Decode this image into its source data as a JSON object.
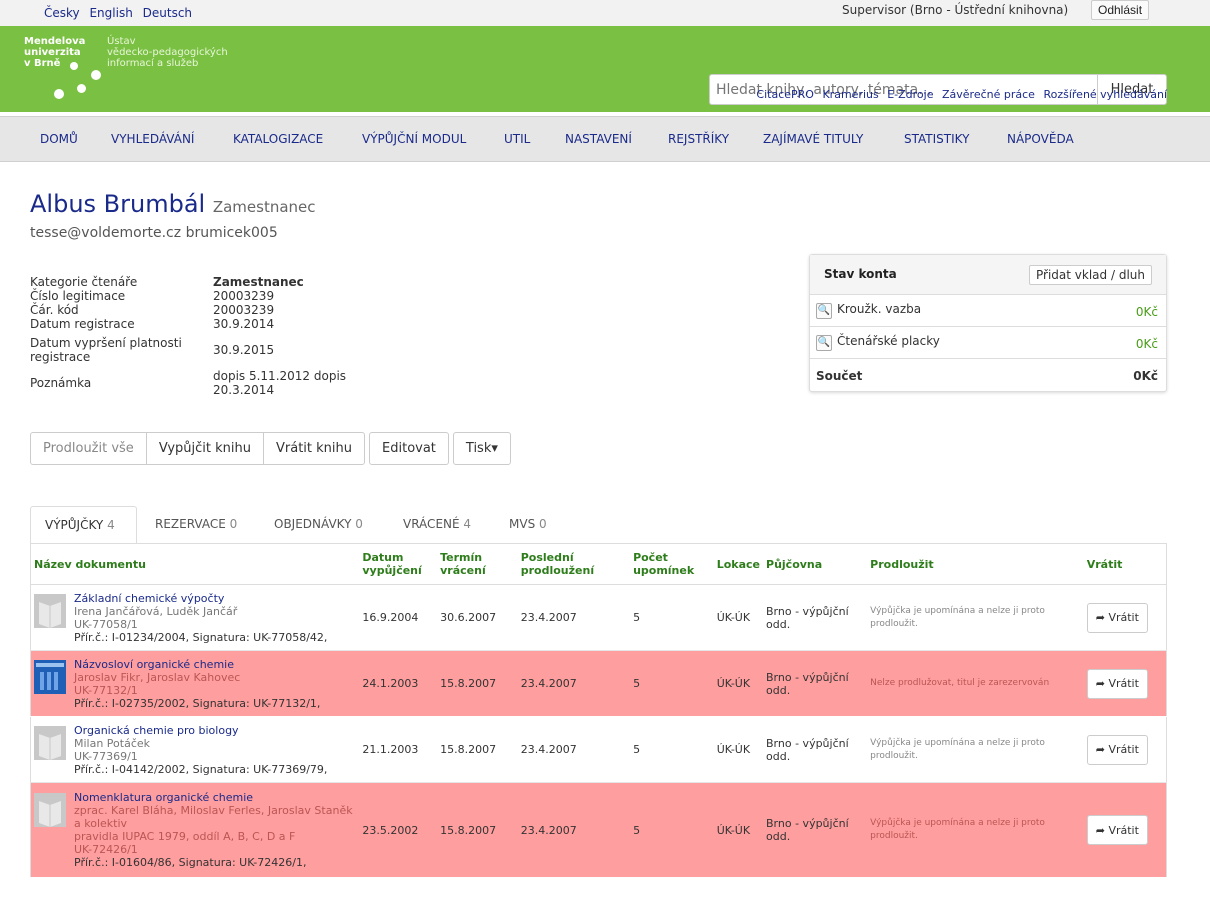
{
  "top": {
    "languages": [
      "Česky",
      "English",
      "Deutsch"
    ],
    "supervisor": "Supervisor (Brno - Ústřední knihovna)",
    "logout": "Odhlásit"
  },
  "header": {
    "logo_lines": [
      "Mendelova",
      "univerzita",
      "v Brně"
    ],
    "unit_lines": [
      "Ústav",
      "vědecko-pedagogických",
      "informací a služeb"
    ],
    "search_placeholder": "Hledat knihy, autory, témata...",
    "search_button": "Hledat",
    "links": [
      "CitacePRO",
      "Kramerius",
      "E-Zdroje",
      "Závěrečné práce",
      "Rozšířené vyhledávání"
    ]
  },
  "nav": [
    "DOMŮ",
    "VYHLEDÁVÁNÍ",
    "KATALOGIZACE",
    "VÝPŮJČNÍ MODUL",
    "UTIL",
    "NASTAVENÍ",
    "REJSTŘÍKY",
    "ZAJÍMAVÉ TITULY",
    "STATISTIKY",
    "NÁPOVĚDA"
  ],
  "patron": {
    "name": "Albus Brumbál",
    "role": "Zamestnanec",
    "email": "tesse@voldemorte.cz",
    "login": "brumicek005",
    "info": [
      {
        "k": "Kategorie čtenáře",
        "v": "Zamestnanec"
      },
      {
        "k": "Číslo legitimace",
        "v": "20003239"
      },
      {
        "k": "Čár. kód",
        "v": "20003239"
      },
      {
        "k": "Datum registrace",
        "v": "30.9.2014"
      },
      {
        "k": "Datum vypršení platnosti registrace",
        "v": "30.9.2015"
      },
      {
        "k": "Poznámka",
        "v": "dopis 5.11.2012 dopis 20.3.2014"
      }
    ]
  },
  "account": {
    "title": "Stav konta",
    "add_button": "Přidat vklad / dluh",
    "rows": [
      {
        "label": "Kroužk. vazba",
        "amount": "0Kč"
      },
      {
        "label": "Čtenářské placky",
        "amount": "0Kč"
      }
    ],
    "sum_label": "Součet",
    "sum_amount": "0Kč"
  },
  "actions": {
    "renew_all": "Prodloužit vše",
    "borrow": "Vypůjčit knihu",
    "return": "Vrátit knihu",
    "edit": "Editovat",
    "print": "Tisk▾"
  },
  "tabs": [
    {
      "label": "VÝPŮJČKY",
      "count": "4"
    },
    {
      "label": "REZERVACE",
      "count": "0"
    },
    {
      "label": "OBJEDNÁVKY",
      "count": "0"
    },
    {
      "label": "VRÁCENÉ",
      "count": "4"
    },
    {
      "label": "MVS",
      "count": "0"
    }
  ],
  "table": {
    "headers": [
      "Název dokumentu",
      "Datum vypůjčení",
      "Termín vrácení",
      "Poslední prodloužení",
      "Počet upomínek",
      "Lokace",
      "Půjčovna",
      "Prodloužit",
      "Vrátit"
    ],
    "rows": [
      {
        "title": "Základní chemické výpočty",
        "authors": "Irena Jančářová, Luděk Jančář",
        "extra": "",
        "code": "UK-77058/1",
        "sign": "Přír.č.: I-01234/2004, Signatura: UK-77058/42,",
        "borrowed": "16.9.2004",
        "due": "30.6.2007",
        "last_renewal": "23.4.2007",
        "reminders": "5",
        "location": "ÚK-ÚK",
        "desk": "Brno - výpůjční odd.",
        "renew_note": "Výpůjčka je upomínána a nelze ji proto prodloužit.",
        "return_label": "Vrátit",
        "highlight": false,
        "cover": "placeholder"
      },
      {
        "title": "Názvosloví organické chemie",
        "authors": "Jaroslav Fikr, Jaroslav Kahovec",
        "extra": "",
        "code": "UK-77132/1",
        "sign": "Přír.č.: I-02735/2002, Signatura: UK-77132/1,",
        "borrowed": "24.1.2003",
        "due": "15.8.2007",
        "last_renewal": "23.4.2007",
        "reminders": "5",
        "location": "ÚK-ÚK",
        "desk": "Brno - výpůjční odd.",
        "renew_note": "Nelze prodlužovat, titul je zarezervován",
        "return_label": "Vrátit",
        "highlight": true,
        "cover": "blue"
      },
      {
        "title": "Organická chemie pro biology",
        "authors": "Milan Potáček",
        "extra": "",
        "code": "UK-77369/1",
        "sign": "Přír.č.: I-04142/2002, Signatura: UK-77369/79,",
        "borrowed": "21.1.2003",
        "due": "15.8.2007",
        "last_renewal": "23.4.2007",
        "reminders": "5",
        "location": "ÚK-ÚK",
        "desk": "Brno - výpůjční odd.",
        "renew_note": "Výpůjčka je upomínána a nelze ji proto prodloužit.",
        "return_label": "Vrátit",
        "highlight": false,
        "cover": "placeholder"
      },
      {
        "title": "Nomenklatura organické chemie",
        "authors": "zprac. Karel Bláha, Miloslav Ferles, Jaroslav Staněk a kolektiv",
        "extra": "pravidla IUPAC 1979, oddíl A, B, C, D a F",
        "code": "UK-72426/1",
        "sign": "Přír.č.: I-01604/86, Signatura: UK-72426/1,",
        "borrowed": "23.5.2002",
        "due": "15.8.2007",
        "last_renewal": "23.4.2007",
        "reminders": "5",
        "location": "ÚK-ÚK",
        "desk": "Brno - výpůjční odd.",
        "renew_note": "Výpůjčka je upomínána a nelze ji proto prodloužit.",
        "return_label": "Vrátit",
        "highlight": true,
        "cover": "placeholder"
      }
    ]
  },
  "colors": {
    "header_green": "#7ac143",
    "link_blue": "#1a2a8a",
    "table_header_green": "#2e7d1b",
    "row_highlight": "#ff9e9e",
    "amount_green": "#4a9b18"
  }
}
